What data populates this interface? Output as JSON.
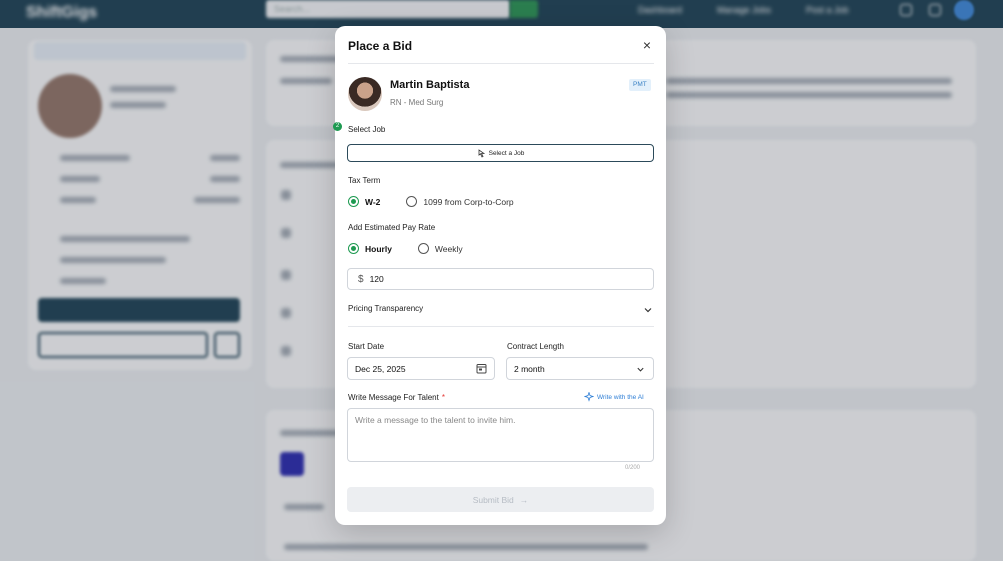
{
  "background": {
    "logo": "ShiftGigs",
    "search_placeholder": "Search...",
    "nav": [
      "Dashboard",
      "Manage Jobs",
      "Post a Job"
    ],
    "user_initials": "MB"
  },
  "modal": {
    "title": "Place a Bid",
    "close_glyph": "×",
    "profile": {
      "name": "Martin Baptista",
      "role": "RN - Med Surg",
      "badge": "PMT"
    },
    "select_job": {
      "label": "Select Job",
      "button": "Select a Job",
      "step": "2"
    },
    "tax_term": {
      "label": "Tax Term",
      "options": [
        "W-2",
        "1099 from Corp-to-Corp"
      ],
      "selected": "W-2"
    },
    "pay_rate": {
      "label": "Add Estimated Pay Rate",
      "options": [
        "Hourly",
        "Weekly"
      ],
      "selected": "Hourly",
      "currency": "$",
      "amount": "120"
    },
    "pricing": {
      "label": "Pricing Transparency",
      "chevron": "⌄"
    },
    "start_date": {
      "label": "Start Date",
      "value": "Dec 25, 2025"
    },
    "contract_length": {
      "label": "Contract Length",
      "value": "2 month"
    },
    "message": {
      "label": "Write Message For Talent",
      "required_mark": "*",
      "ai_link": "Write with the AI",
      "placeholder": "Write a message to the talent to invite him.",
      "counter": "0/200"
    },
    "submit": {
      "label": "Submit Bid",
      "arrow": "→"
    }
  }
}
